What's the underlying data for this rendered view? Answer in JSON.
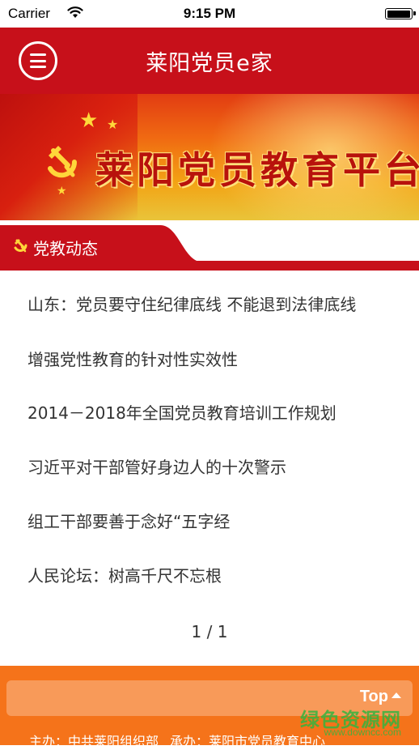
{
  "status_bar": {
    "carrier": "Carrier",
    "time": "9:15 PM",
    "battery_level": 1.0
  },
  "nav": {
    "title": "莱阳党员e家",
    "menu_icon": "menu-icon"
  },
  "banner": {
    "title": "莱阳党员教育平台",
    "emblem_icon": "party-emblem-icon"
  },
  "section": {
    "title": "党教动态",
    "icon": "party-emblem-icon"
  },
  "news": [
    {
      "title": "山东：党员要守住纪律底线 不能退到法律底线"
    },
    {
      "title": "增强党性教育的针对性实效性"
    },
    {
      "title": "2014－2018年全国党员教育培训工作规划"
    },
    {
      "title": "习近平对干部管好身边人的十次警示"
    },
    {
      "title": "组工干部要善于念好“五字经"
    },
    {
      "title": "人民论坛：树高千尺不忘根"
    }
  ],
  "pagination": {
    "text": "1 / 1"
  },
  "footer": {
    "top_label": "Top",
    "host": "主办：中共莱阳组织部",
    "organizer": "承办：莱阳市党员教育中心",
    "watermark": "绿色资源网",
    "watermark_url": "www.downcc.com"
  },
  "colors": {
    "nav_red": "#c7101a",
    "footer_orange": "#f5731a",
    "banner_text": "#b8120c"
  }
}
